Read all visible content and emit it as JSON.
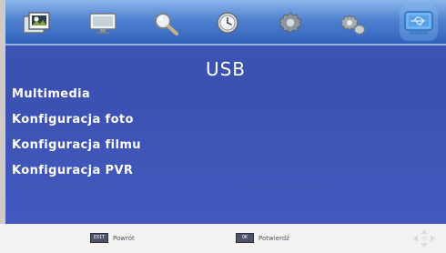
{
  "menu": {
    "title": "USB",
    "items": [
      {
        "label": "Multimedia"
      },
      {
        "label": "Konfiguracja foto"
      },
      {
        "label": "Konfiguracja filmu"
      },
      {
        "label": "Konfiguracja PVR"
      }
    ]
  },
  "tabs": [
    {
      "icon": "image-icon"
    },
    {
      "icon": "tv-icon"
    },
    {
      "icon": "search-icon"
    },
    {
      "icon": "clock-icon"
    },
    {
      "icon": "gear-icon"
    },
    {
      "icon": "settings-gear-icon"
    },
    {
      "icon": "usb-icon",
      "selected": true
    }
  ],
  "footer": {
    "back_key": "EXIT",
    "back_label": "Powrót",
    "confirm_key": "OK",
    "confirm_label": "Potwierdź"
  },
  "colors": {
    "panel": "#3b51b1",
    "top_bar": "#4f80cf",
    "footer": "#f3f2f0",
    "text": "#ffffff"
  }
}
